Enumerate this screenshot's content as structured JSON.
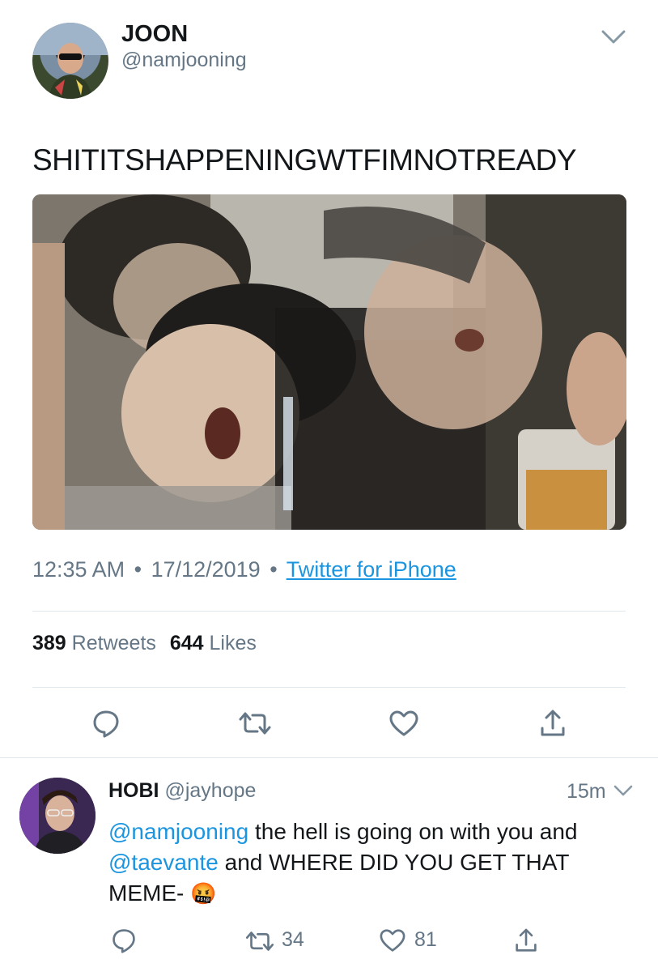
{
  "tweet": {
    "author_name": "JOON",
    "author_handle": "@namjooning",
    "text": "SHITITSHAPPENINGWTFIMNOTREADY",
    "time": "12:35 AM",
    "date": "17/12/2019",
    "separator": "•",
    "source": "Twitter for iPhone",
    "retweets_count": "389",
    "retweets_label": "Retweets",
    "likes_count": "644",
    "likes_label": "Likes"
  },
  "reply": {
    "author_name": "HOBI",
    "author_handle": "@jayhope",
    "age": "15m",
    "mention1": "@namjooning",
    "text1": " the hell is going on with you and ",
    "mention2": "@taevante",
    "text2": " and WHERE DID YOU GET THAT MEME-",
    "emoji": "🤬",
    "retweet_count": "34",
    "like_count": "81"
  },
  "colors": {
    "link": "#1b95e0",
    "muted": "#657786",
    "icon": "#657786",
    "divider": "#e1e8ed"
  },
  "icons": [
    "chevron-down-icon",
    "reply-icon",
    "retweet-icon",
    "heart-icon",
    "share-icon"
  ]
}
